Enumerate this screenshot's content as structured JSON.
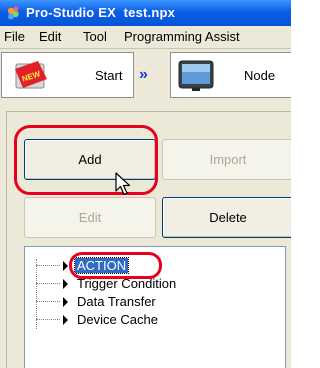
{
  "window": {
    "app_name": "Pro-Studio EX",
    "file_name": "test.npx",
    "app_icon": "pro-studio-app-icon"
  },
  "menu": [
    "File",
    "Edit",
    "Tool",
    "Programming Assist"
  ],
  "nav": {
    "start_label": "Start",
    "start_badge": "NEW",
    "node_label": "Node",
    "chevron": "»"
  },
  "buttons": {
    "add": "Add",
    "import": "Import",
    "edit": "Edit",
    "delete": "Delete"
  },
  "tree": {
    "items": [
      {
        "label": "ACTION",
        "selected": true
      },
      {
        "label": "Trigger Condition",
        "selected": false
      },
      {
        "label": "Data Transfer",
        "selected": false
      },
      {
        "label": "Device Cache",
        "selected": false
      }
    ]
  },
  "colors": {
    "callout": "#e8001c",
    "selection": "#316ac5",
    "title_bar": "#0a5fe6"
  }
}
